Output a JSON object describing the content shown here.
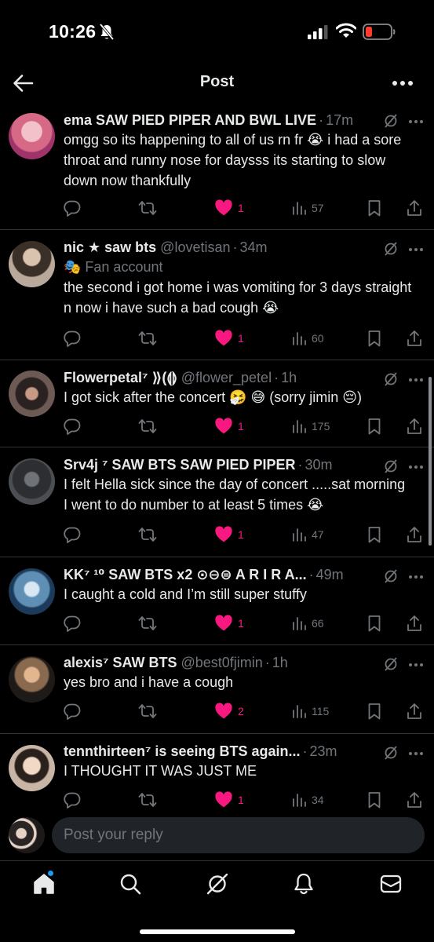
{
  "status_bar": {
    "time": "10:26",
    "icons": [
      "bell-slash-icon",
      "signal-icon",
      "wifi-icon",
      "battery-low-icon"
    ],
    "battery_color": "#ff3b30"
  },
  "header": {
    "title": "Post",
    "icons": [
      "back-arrow-icon",
      "more-icon"
    ]
  },
  "colors": {
    "like": "#f91880",
    "muted": "#71767b",
    "divider": "#2f3336",
    "accent": "#1d9bf0"
  },
  "posts": [
    {
      "name": "ema SAW PIED PIPER AND BWL LIVE",
      "handle": "",
      "time": "17m",
      "badge": "",
      "text": "omgg so its happening to all of us rn fr 😭 i had a sore throat and runny nose for daysss its starting to slow down now thankfully",
      "likes": "1",
      "views": "57",
      "liked": true
    },
    {
      "name": "nic ★ saw bts",
      "handle": "@lovetisan",
      "time": "34m",
      "badge": "🎭 Fan account",
      "text": "the second i got home i was vomiting for 3 days straight n now i have such a bad cough 😭",
      "likes": "1",
      "views": "60",
      "liked": true
    },
    {
      "name": "Flowerpetal⁷ ⟫(⟬⟭",
      "handle": "@flower_petel",
      "time": "1h",
      "badge": "",
      "text": "I got sick after the concert 🤧 😅 (sorry jimin 😔)",
      "likes": "1",
      "views": "175",
      "liked": true
    },
    {
      "name": "Srv4j ⁷ SAW BTS SAW PIED PIPER",
      "handle": "",
      "time": "30m",
      "badge": "",
      "text": "I felt Hella sick since the day of concert .....sat morning I went to do number to at least 5 times 😭",
      "likes": "1",
      "views": "47",
      "liked": true
    },
    {
      "name": "KK⁷ ¹⁰ SAW BTS x2 ⊙⊖⊜ A R I R A...",
      "handle": "",
      "time": "49m",
      "badge": "",
      "text": "I caught a cold and I’m still super stuffy",
      "likes": "1",
      "views": "66",
      "liked": true
    },
    {
      "name": "alexis⁷ SAW BTS",
      "handle": "@best0fjimin",
      "time": "1h",
      "badge": "",
      "text": "yes bro and i have a cough",
      "likes": "2",
      "views": "115",
      "liked": true
    },
    {
      "name": "tennthirteen⁷ is seeing BTS again...",
      "handle": "",
      "time": "23m",
      "badge": "",
      "text": "I THOUGHT IT WAS JUST ME",
      "likes": "1",
      "views": "34",
      "liked": true
    }
  ],
  "reply_bar": {
    "placeholder": "Post your reply"
  },
  "bottom_nav": {
    "items": [
      "home-icon",
      "search-icon",
      "grok-icon",
      "notifications-icon",
      "messages-icon"
    ],
    "active": "home-icon",
    "has_new_indicator": true
  }
}
